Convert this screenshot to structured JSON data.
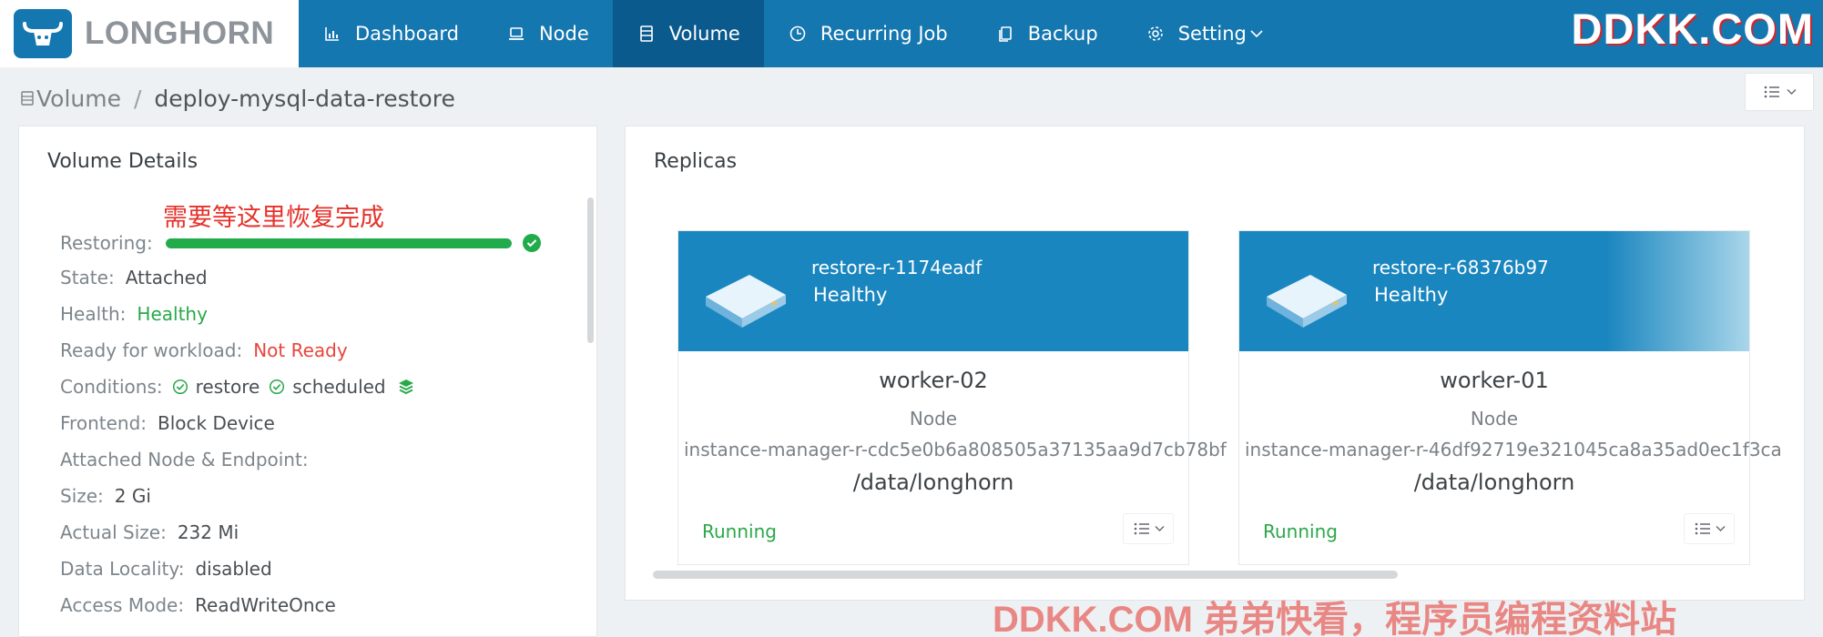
{
  "brand": {
    "logo_text": "LONGHORN",
    "watermark": "DDKK.COM",
    "watermark_bottom": "DDKK.COM 弟弟快看，程序员编程资料站"
  },
  "nav": {
    "items": [
      {
        "label": "Dashboard",
        "icon": "bar-chart-icon"
      },
      {
        "label": "Node",
        "icon": "laptop-icon"
      },
      {
        "label": "Volume",
        "icon": "database-icon",
        "active": true
      },
      {
        "label": "Recurring Job",
        "icon": "clock-icon"
      },
      {
        "label": "Backup",
        "icon": "copy-icon"
      },
      {
        "label": "Setting",
        "icon": "gear-icon"
      }
    ]
  },
  "breadcrumb": {
    "parent": "Volume",
    "separator": "/",
    "current": "deploy-mysql-data-restore"
  },
  "details": {
    "title": "Volume Details",
    "annotation": "需要等这里恢复完成",
    "restoring_label": "Restoring:",
    "restoring_progress": 1.0,
    "state_label": "State:",
    "state_value": "Attached",
    "health_label": "Health:",
    "health_value": "Healthy",
    "ready_label": "Ready for workload:",
    "ready_value": "Not Ready",
    "conditions_label": "Conditions:",
    "condition_1": "restore",
    "condition_2": "scheduled",
    "frontend_label": "Frontend:",
    "frontend_value": "Block Device",
    "attached_label": "Attached Node & Endpoint:",
    "size_label": "Size:",
    "size_value": "2 Gi",
    "actual_size_label": "Actual Size:",
    "actual_size_value": "232 Mi",
    "locality_label": "Data Locality:",
    "locality_value": "disabled",
    "access_label": "Access Mode:",
    "access_value": "ReadWriteOnce"
  },
  "replicas": {
    "title": "Replicas",
    "items": [
      {
        "name": "restore-r-1174eadf",
        "health": "Healthy",
        "node": "worker-02",
        "node_label": "Node",
        "instance": "instance-manager-r-cdc5e0b6a808505a37135aa9d7cb78bf",
        "path": "/data/longhorn",
        "status": "Running"
      },
      {
        "name": "restore-r-68376b97",
        "health": "Healthy",
        "node": "worker-01",
        "node_label": "Node",
        "instance": "instance-manager-r-46df92719e321045ca8a35ad0ec1f3ca",
        "path": "/data/longhorn",
        "status": "Running"
      }
    ]
  },
  "colors": {
    "nav_bg": "#1577af",
    "nav_active": "#0b5a8e",
    "success": "#22ab4b",
    "danger": "#e8453c",
    "card_head": "#1a86bf"
  }
}
